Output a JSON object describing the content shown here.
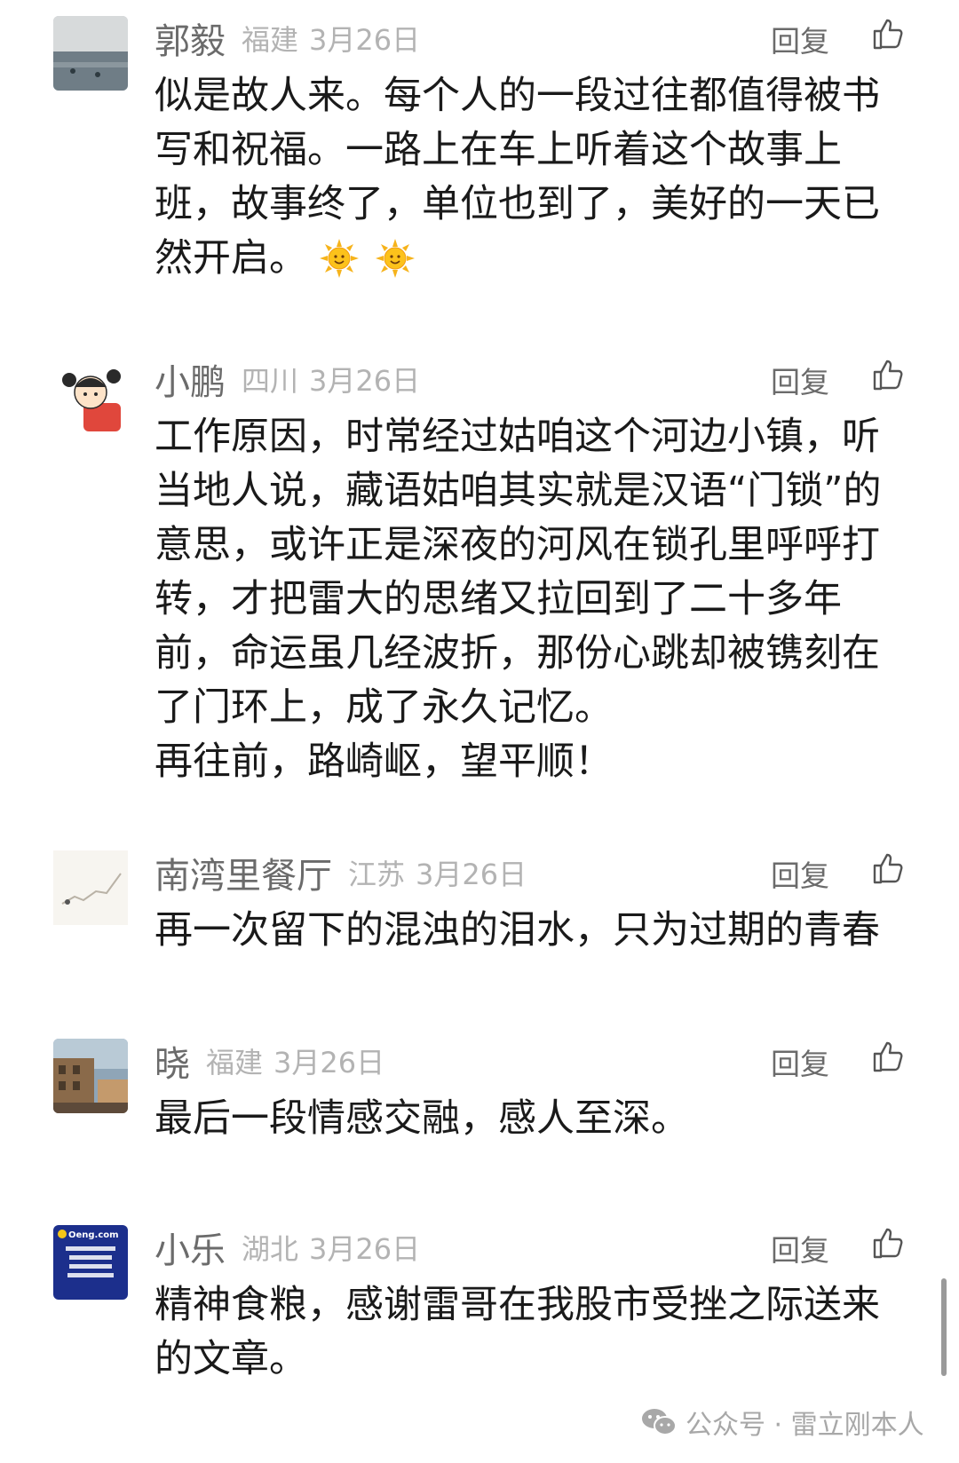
{
  "comments": [
    {
      "name": "郭毅",
      "region": "福建",
      "date": "3月26日",
      "reply_label": "回复",
      "lines": [
        "似是故人来。每个人的一段过往都值得被书",
        "写和祝福。一路上在车上听着这个故事上",
        "班，故事终了，单位也到了，美好的一天已",
        "然开启。"
      ],
      "emoji": "sun-emoji"
    },
    {
      "name": "小鹏",
      "region": "四川",
      "date": "3月26日",
      "reply_label": "回复",
      "lines": [
        "工作原因，时常经过姑咱这个河边小镇，听",
        "当地人说，藏语姑咱其实就是汉语“门锁”的",
        "意思，或许正是深夜的河风在锁孔里呼呼打",
        "转，才把雷大的思绪又拉回到了二十多年",
        "前，命运虽几经波折，那份心跳却被镌刻在",
        "了门环上，成了永久记忆。",
        "再往前，路崎岖，望平顺！"
      ]
    },
    {
      "name": "南湾里餐厅",
      "region": "江苏",
      "date": "3月26日",
      "reply_label": "回复",
      "lines": [
        "再一次留下的混浊的泪水，只为过期的青春"
      ]
    },
    {
      "name": "晓",
      "region": "福建",
      "date": "3月26日",
      "reply_label": "回复",
      "lines": [
        "最后一段情感交融，感人至深。"
      ]
    },
    {
      "name": "小乐",
      "region": "湖北",
      "date": "3月26日",
      "reply_label": "回复",
      "lines": [
        "精神食粮，感谢雷哥在我股市受挫之际送来",
        "的文章。"
      ]
    }
  ],
  "watermark": {
    "text": "公众号 · 雷立刚本人",
    "icon": "wechat-icon"
  },
  "avatar_logo_text": "Oeng.com",
  "colors": {
    "name": "#6b6b6b",
    "meta": "#b3b3b3",
    "body": "#1a1a1a"
  }
}
